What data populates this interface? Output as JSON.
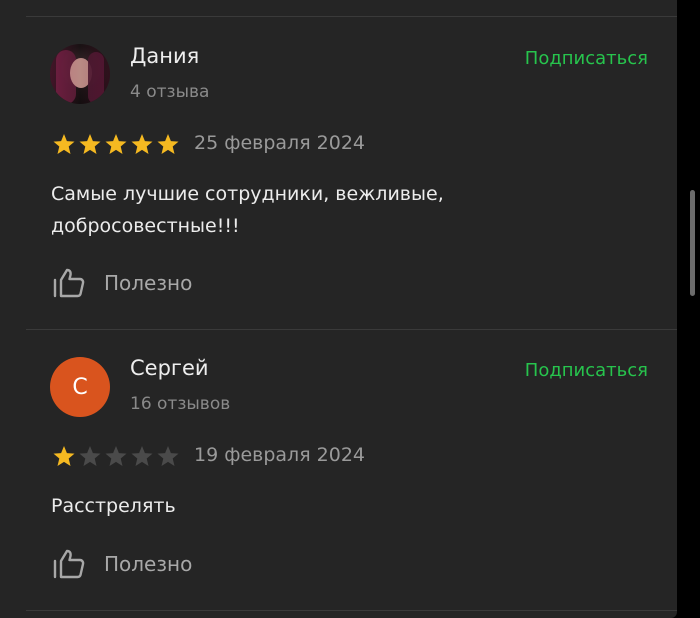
{
  "reviews": [
    {
      "author": "Дания",
      "reviews_count": "4 отзыва",
      "subscribe_label": "Подписаться",
      "rating": 5,
      "max_rating": 5,
      "date": "25 февраля 2024",
      "text_line1": "Самые лучшие сотрудники, вежливые,",
      "text_line2": "добросовестные!!!",
      "useful_label": "Полезно",
      "avatar_type": "photo"
    },
    {
      "author": "Сергей",
      "avatar_letter": "С",
      "reviews_count": "16 отзывов",
      "subscribe_label": "Подписаться",
      "rating": 1,
      "max_rating": 5,
      "date": "19 февраля 2024",
      "text_line1": "Расстрелять",
      "useful_label": "Полезно",
      "avatar_type": "letter"
    }
  ],
  "colors": {
    "background": "#252525",
    "accent_green": "#27c44d",
    "star_filled": "#f5b921",
    "star_empty": "#4a4a4a",
    "avatar_letter_bg": "#d9541e"
  },
  "icons": {
    "useful": "thumbs-up-icon",
    "star": "star-icon"
  }
}
